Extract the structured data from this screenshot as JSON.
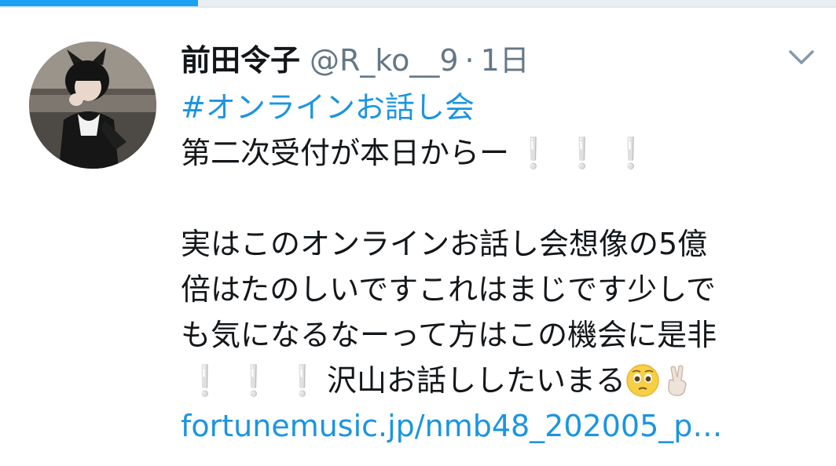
{
  "tweet": {
    "author_name": "前田令子",
    "handle": "@R_ko__9",
    "separator": "·",
    "time": "1日",
    "hashtag": "#オンラインお話し会",
    "line1": "第二次受付が本日からー",
    "exclamation": "❕",
    "para_line1": "実はこのオンラインお話し会想像の5億",
    "para_line2": "倍はたのしいですこれはまじです少しで",
    "para_line3": "も気になるなーって方はこの機会に是非",
    "para_line4": "沢山お話ししたいまる",
    "emoji_pleading": "pleading-face",
    "emoji_victory": "victory-hand",
    "link_text": "fortunemusic.jp/nmb48_202005_p…"
  },
  "icons": {
    "menu": "chevron-down-icon"
  },
  "colors": {
    "link": "#1b95e0",
    "text": "#14171a",
    "muted": "#657786",
    "accent": "#1da1f2"
  }
}
